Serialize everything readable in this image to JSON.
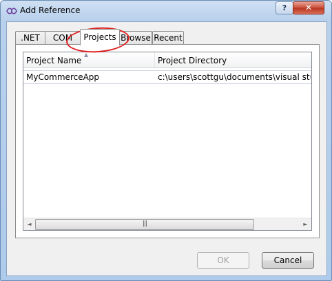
{
  "window": {
    "title": "Add Reference",
    "help_label": "?",
    "close_label": "✕"
  },
  "tabs": [
    {
      "label": ".NET"
    },
    {
      "label": "COM"
    },
    {
      "label": "Projects"
    },
    {
      "label": "Browse"
    },
    {
      "label": "Recent"
    }
  ],
  "active_tab": "Projects",
  "list": {
    "columns": [
      {
        "label": "Project Name"
      },
      {
        "label": "Project Directory"
      }
    ],
    "rows": [
      {
        "name": "MyCommerceApp",
        "directory": "c:\\users\\scottgu\\documents\\visual stud"
      }
    ]
  },
  "scrollbar": {
    "left_arrow": "◄",
    "right_arrow": "►",
    "grip": "|||"
  },
  "buttons": {
    "ok_label": "OK",
    "cancel_label": "Cancel"
  },
  "colors": {
    "annotation_ring": "#e02020",
    "title_bar": "#b8d0ec"
  }
}
